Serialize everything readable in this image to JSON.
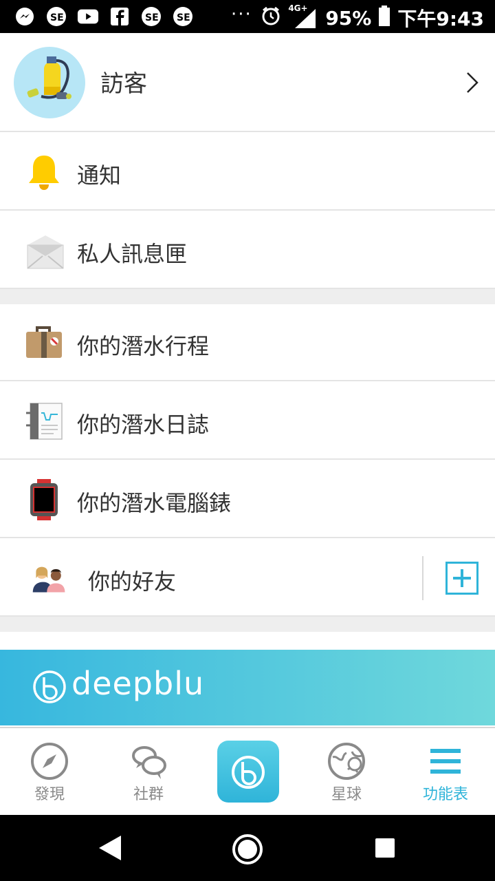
{
  "status_bar": {
    "time": "下午9:43",
    "battery": "95%",
    "network": "4G+",
    "overflow": "···",
    "left_icons": [
      "messenger-icon",
      "se-icon",
      "youtube-icon",
      "facebook-icon",
      "se-icon",
      "se-icon"
    ]
  },
  "profile": {
    "name": "訪客"
  },
  "menu": {
    "notifications": "通知",
    "inbox": "私人訊息匣",
    "trips": "你的潛水行程",
    "logbook": "你的潛水日誌",
    "computer": "你的潛水電腦錶",
    "friends": "你的好友"
  },
  "banner": {
    "brand": "deepblu"
  },
  "tabs": [
    {
      "label": "發現",
      "icon": "compass-icon"
    },
    {
      "label": "社群",
      "icon": "chat-bubbles-icon"
    },
    {
      "label": "",
      "icon": "deepblu-logo-icon"
    },
    {
      "label": "星球",
      "icon": "globe-icon"
    },
    {
      "label": "功能表",
      "icon": "menu-icon"
    }
  ],
  "colors": {
    "accent": "#2fb4d9",
    "banner_start": "#37b7de",
    "banner_end": "#6fd8dc"
  }
}
